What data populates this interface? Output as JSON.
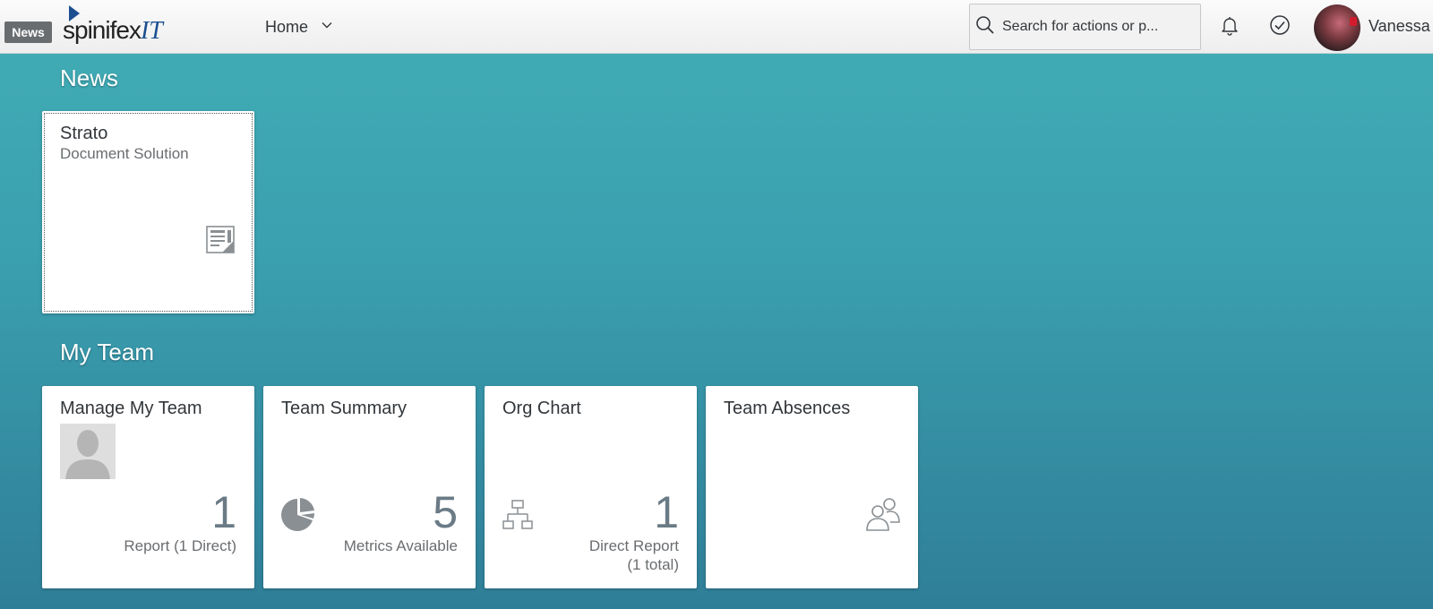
{
  "header": {
    "badge": "News",
    "logo": {
      "name": "spinifex",
      "suffix": "IT"
    },
    "home_label": "Home",
    "search_placeholder": "Search for actions or p...",
    "user_name": "Vanessa"
  },
  "sections": {
    "news": {
      "title": "News",
      "tiles": [
        {
          "title": "Strato",
          "subtitle": "Document Solution",
          "icon": "news-document-icon"
        }
      ]
    },
    "my_team": {
      "title": "My Team",
      "tiles": [
        {
          "title": "Manage My Team",
          "number": "1",
          "footer": "Report (1 Direct)",
          "icon": "person-placeholder-icon"
        },
        {
          "title": "Team Summary",
          "number": "5",
          "footer": "Metrics Available",
          "icon": "pie-chart-icon"
        },
        {
          "title": "Org Chart",
          "number": "1",
          "footer_line1": "Direct Report",
          "footer_line2": "(1 total)",
          "icon": "org-chart-icon"
        },
        {
          "title": "Team Absences",
          "icon": "group-icon"
        }
      ]
    }
  },
  "colors": {
    "background_top": "#41aeb6",
    "background_bottom": "#2f7e98",
    "logo_blue": "#1b4f8f",
    "tile_number": "#6a7b86"
  }
}
